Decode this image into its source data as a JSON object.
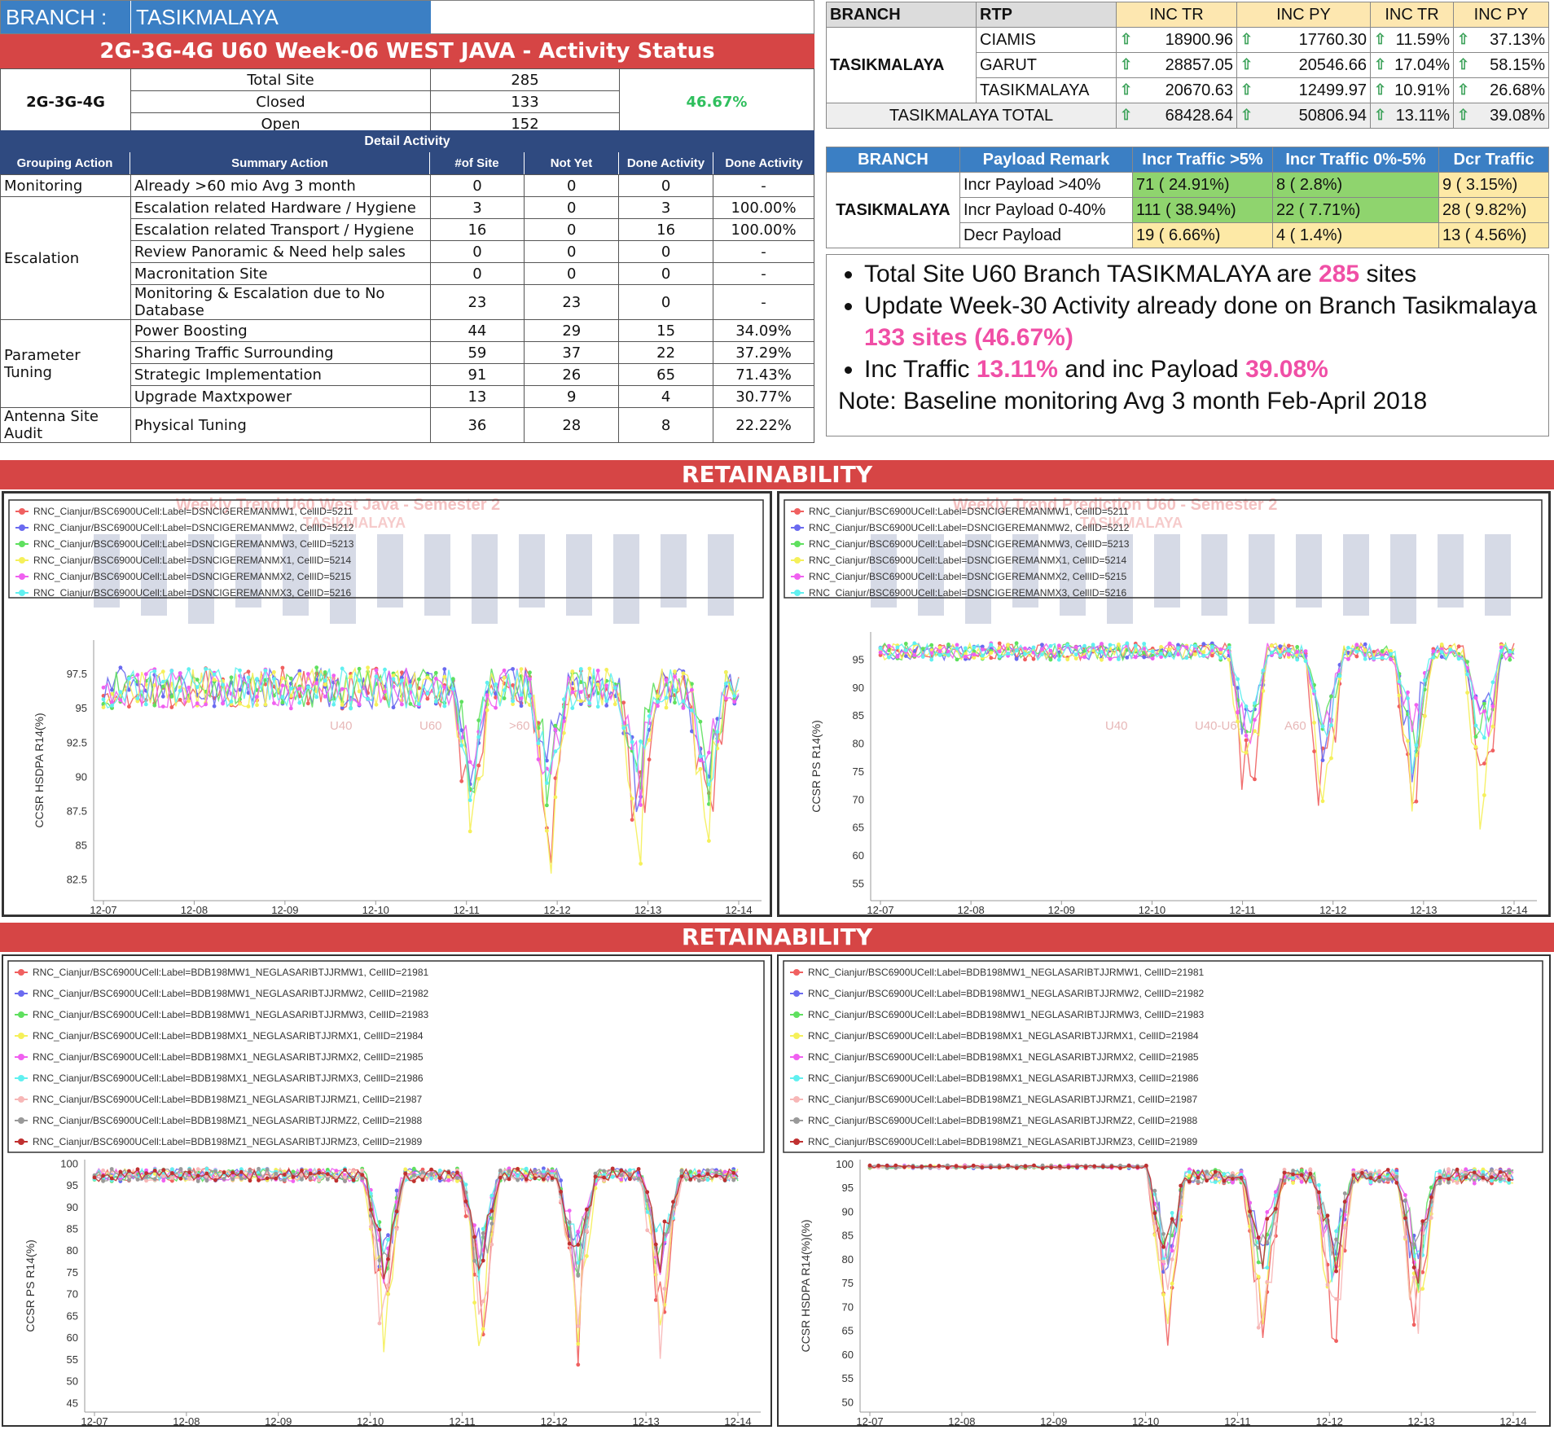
{
  "branch_header": {
    "label": "BRANCH :",
    "value": "TASIKMALAYA"
  },
  "title": "2G-3G-4G U60 Week-06 WEST JAVA - Activity Status",
  "summary": {
    "tech": "2G-3G-4G",
    "rows": [
      {
        "label": "Total Site",
        "value": "285"
      },
      {
        "label": "Closed",
        "value": "133"
      },
      {
        "label": "Open",
        "value": "152"
      }
    ],
    "percent": "46.67%"
  },
  "detail_title": "Detail Activity",
  "detail_columns": [
    "Grouping Action",
    "Summary Action",
    "#of Site",
    "Not Yet",
    "Done Activity",
    "Done Activity"
  ],
  "detail_groups": [
    {
      "group": "Monitoring",
      "rows": [
        {
          "action": "Already >60 mio Avg 3 month",
          "sites": "0",
          "not_yet": "0",
          "done": "0",
          "pct": "-"
        }
      ]
    },
    {
      "group": "Escalation",
      "rows": [
        {
          "action": "Escalation related Hardware / Hygiene",
          "sites": "3",
          "not_yet": "0",
          "done": "3",
          "pct": "100.00%"
        },
        {
          "action": "Escalation related Transport / Hygiene",
          "sites": "16",
          "not_yet": "0",
          "done": "16",
          "pct": "100.00%"
        },
        {
          "action": "Review Panoramic & Need help sales",
          "sites": "0",
          "not_yet": "0",
          "done": "0",
          "pct": "-"
        },
        {
          "action": "Macronitation Site",
          "sites": "0",
          "not_yet": "0",
          "done": "0",
          "pct": "-"
        },
        {
          "action": "Monitoring & Escalation due to No Database",
          "sites": "23",
          "not_yet": "23",
          "done": "0",
          "pct": "-"
        }
      ]
    },
    {
      "group": "Parameter Tuning",
      "rows": [
        {
          "action": "Power Boosting",
          "sites": "44",
          "not_yet": "29",
          "done": "15",
          "pct": "34.09%"
        },
        {
          "action": "Sharing Traffic Surrounding",
          "sites": "59",
          "not_yet": "37",
          "done": "22",
          "pct": "37.29%"
        },
        {
          "action": "Strategic Implementation",
          "sites": "91",
          "not_yet": "26",
          "done": "65",
          "pct": "71.43%"
        },
        {
          "action": "Upgrade Maxtxpower",
          "sites": "13",
          "not_yet": "9",
          "done": "4",
          "pct": "30.77%"
        }
      ]
    },
    {
      "group": "Antenna Site Audit",
      "rows": [
        {
          "action": "Physical Tuning",
          "sites": "36",
          "not_yet": "28",
          "done": "8",
          "pct": "22.22%"
        }
      ]
    }
  ],
  "traffic_table": {
    "headers": [
      "BRANCH",
      "RTP",
      "INC TR",
      "INC PY",
      "INC TR",
      "INC PY"
    ],
    "branch": "TASIKMALAYA",
    "rows": [
      {
        "rtp": "CIAMIS",
        "tr": "18900.96",
        "py": "17760.30",
        "inc_tr": "11.59%",
        "inc_py": "37.13%"
      },
      {
        "rtp": "GARUT",
        "tr": "28857.05",
        "py": "20546.66",
        "inc_tr": "17.04%",
        "inc_py": "58.15%"
      },
      {
        "rtp": "TASIKMALAYA",
        "tr": "20670.63",
        "py": "12499.97",
        "inc_tr": "10.91%",
        "inc_py": "26.68%"
      }
    ],
    "total": {
      "label": "TASIKMALAYA TOTAL",
      "tr": "68428.64",
      "py": "50806.94",
      "inc_tr": "13.11%",
      "inc_py": "39.08%"
    },
    "arrow_icon": "up-arrow-icon"
  },
  "payload_table": {
    "headers": [
      "BRANCH",
      "Payload Remark",
      "Incr Traffic >5%",
      "Incr Traffic 0%-5%",
      "Dcr Traffic"
    ],
    "branch": "TASIKMALAYA",
    "rows": [
      {
        "remark": "Incr Payload >40%",
        "a": "71 ( 24.91%)",
        "b": "8 ( 2.8%)",
        "c": "9 ( 3.15%)"
      },
      {
        "remark": "Incr Payload 0-40%",
        "a": "111 ( 38.94%)",
        "b": "22 ( 7.71%)",
        "c": "28 ( 9.82%)"
      },
      {
        "remark": "Decr Payload",
        "a": "19 ( 6.66%)",
        "b": "4 ( 1.4%)",
        "c": "13 ( 4.56%)"
      }
    ]
  },
  "notes": {
    "b1_pre": "Total Site U60 Branch TASIKMALAYA are ",
    "b1_hl": "285",
    "b1_post": " sites",
    "b2_pre": "Update Week-30 Activity already done on Branch Tasikmalaya ",
    "b2_hl": "133 sites (46.67%)",
    "b3_pre": "Inc Traffic ",
    "b3_hl1": "13.11%",
    "b3_mid": " and inc Payload ",
    "b3_hl2": "39.08%",
    "note": "Note: Baseline monitoring Avg 3 month Feb-April 2018"
  },
  "band_title": "RETAINABILITY",
  "colors": {
    "red": "#d64545",
    "blue": "#3b7fc4",
    "navy": "#2f4a80",
    "green_pct": "#2fbf5d",
    "pink": "#f04fa6"
  },
  "charts": [
    {
      "name": "chart-1",
      "ghost_title": "Weekly Trend U60 West Java - Semester 2",
      "ghost_sub": "TASIKMALAYA",
      "ghost_legend": [
        "U40",
        "U60",
        ">60"
      ],
      "ylabel": "CCSR HSDPA R14(%)",
      "yticks": [
        "97.5",
        "95",
        "92.5",
        "90",
        "87.5",
        "85",
        "82.5"
      ],
      "xticks": [
        "12-07",
        "12-08",
        "12-09",
        "12-10",
        "12-11",
        "12-12",
        "12-13",
        "12-14"
      ],
      "legend": [
        {
          "label": "RNC_Cianjur/BSC6900UCell:Label=DSNCIGEREMANMW1, CellID=5211",
          "color": "#f06060"
        },
        {
          "label": "RNC_Cianjur/BSC6900UCell:Label=DSNCIGEREMANMW2, CellID=5212",
          "color": "#6a6af0"
        },
        {
          "label": "RNC_Cianjur/BSC6900UCell:Label=DSNCIGEREMANMW3, CellID=5213",
          "color": "#5fe05f"
        },
        {
          "label": "RNC_Cianjur/BSC6900UCell:Label=DSNCIGEREMANMX1, CellID=5214",
          "color": "#f5f05a"
        },
        {
          "label": "RNC_Cianjur/BSC6900UCell:Label=DSNCIGEREMANMX2, CellID=5215",
          "color": "#f060f0"
        },
        {
          "label": "RNC_Cianjur/BSC6900UCell:Label=DSNCIGEREMANMX3, CellID=5216",
          "color": "#60f0f0"
        }
      ]
    },
    {
      "name": "chart-2",
      "ghost_title": "Weekly Trend Prediction U60 - Semester 2",
      "ghost_sub": "TASIKMALAYA",
      "ghost_legend": [
        "U40",
        "U40-U60",
        "A60"
      ],
      "ylabel": "CCSR PS R14(%)",
      "yticks": [
        "95",
        "90",
        "85",
        "80",
        "75",
        "70",
        "65",
        "60",
        "55"
      ],
      "xticks": [
        "12-07",
        "12-08",
        "12-09",
        "12-10",
        "12-11",
        "12-12",
        "12-13",
        "12-14"
      ],
      "legend": [
        {
          "label": "RNC_Cianjur/BSC6900UCell:Label=DSNCIGEREMANMW1, CellID=5211",
          "color": "#f06060"
        },
        {
          "label": "RNC_Cianjur/BSC6900UCell:Label=DSNCIGEREMANMW2, CellID=5212",
          "color": "#6a6af0"
        },
        {
          "label": "RNC_Cianjur/BSC6900UCell:Label=DSNCIGEREMANMW3, CellID=5213",
          "color": "#5fe05f"
        },
        {
          "label": "RNC_Cianjur/BSC6900UCell:Label=DSNCIGEREMANMX1, CellID=5214",
          "color": "#f5f05a"
        },
        {
          "label": "RNC_Cianjur/BSC6900UCell:Label=DSNCIGEREMANMX2, CellID=5215",
          "color": "#f060f0"
        },
        {
          "label": "RNC_Cianjur/BSC6900UCell:Label=DSNCIGEREMANMX3, CellID=5216",
          "color": "#60f0f0"
        }
      ]
    },
    {
      "name": "chart-3",
      "ylabel": "CCSR PS R14(%)",
      "yticks": [
        "100",
        "95",
        "90",
        "85",
        "80",
        "75",
        "70",
        "65",
        "60",
        "55",
        "50",
        "45"
      ],
      "xticks": [
        "12-07",
        "12-08",
        "12-09",
        "12-10",
        "12-11",
        "12-12",
        "12-13",
        "12-14"
      ],
      "legend": [
        {
          "label": "RNC_Cianjur/BSC6900UCell:Label=BDB198MW1_NEGLASARIBTJJRMW1, CellID=21981",
          "color": "#f06060"
        },
        {
          "label": "RNC_Cianjur/BSC6900UCell:Label=BDB198MW1_NEGLASARIBTJJRMW2, CellID=21982",
          "color": "#6a6af0"
        },
        {
          "label": "RNC_Cianjur/BSC6900UCell:Label=BDB198MW1_NEGLASARIBTJJRMW3, CellID=21983",
          "color": "#5fe05f"
        },
        {
          "label": "RNC_Cianjur/BSC6900UCell:Label=BDB198MX1_NEGLASARIBTJJRMX1, CellID=21984",
          "color": "#f5f05a"
        },
        {
          "label": "RNC_Cianjur/BSC6900UCell:Label=BDB198MX1_NEGLASARIBTJJRMX2, CellID=21985",
          "color": "#f060f0"
        },
        {
          "label": "RNC_Cianjur/BSC6900UCell:Label=BDB198MX1_NEGLASARIBTJJRMX3, CellID=21986",
          "color": "#60f0f0"
        },
        {
          "label": "RNC_Cianjur/BSC6900UCell:Label=BDB198MZ1_NEGLASARIBTJJRMZ1, CellID=21987",
          "color": "#f7b7b7"
        },
        {
          "label": "RNC_Cianjur/BSC6900UCell:Label=BDB198MZ1_NEGLASARIBTJJRMZ2, CellID=21988",
          "color": "#999999"
        },
        {
          "label": "RNC_Cianjur/BSC6900UCell:Label=BDB198MZ1_NEGLASARIBTJJRMZ3, CellID=21989",
          "color": "#c03030"
        }
      ]
    },
    {
      "name": "chart-4",
      "ylabel": "CCSR HSDPA R14(%)(%)",
      "yticks": [
        "100",
        "95",
        "90",
        "85",
        "80",
        "75",
        "70",
        "65",
        "60",
        "55",
        "50"
      ],
      "xticks": [
        "12-07",
        "12-08",
        "12-09",
        "12-10",
        "12-11",
        "12-12",
        "12-13",
        "12-14"
      ],
      "legend": [
        {
          "label": "RNC_Cianjur/BSC6900UCell:Label=BDB198MW1_NEGLASARIBTJJRMW1, CellID=21981",
          "color": "#f06060"
        },
        {
          "label": "RNC_Cianjur/BSC6900UCell:Label=BDB198MW1_NEGLASARIBTJJRMW2, CellID=21982",
          "color": "#6a6af0"
        },
        {
          "label": "RNC_Cianjur/BSC6900UCell:Label=BDB198MW1_NEGLASARIBTJJRMW3, CellID=21983",
          "color": "#5fe05f"
        },
        {
          "label": "RNC_Cianjur/BSC6900UCell:Label=BDB198MX1_NEGLASARIBTJJRMX1, CellID=21984",
          "color": "#f5f05a"
        },
        {
          "label": "RNC_Cianjur/BSC6900UCell:Label=BDB198MX1_NEGLASARIBTJJRMX2, CellID=21985",
          "color": "#f060f0"
        },
        {
          "label": "RNC_Cianjur/BSC6900UCell:Label=BDB198MX1_NEGLASARIBTJJRMX3, CellID=21986",
          "color": "#60f0f0"
        },
        {
          "label": "RNC_Cianjur/BSC6900UCell:Label=BDB198MZ1_NEGLASARIBTJJRMZ1, CellID=21987",
          "color": "#f7b7b7"
        },
        {
          "label": "RNC_Cianjur/BSC6900UCell:Label=BDB198MZ1_NEGLASARIBTJJRMZ2, CellID=21988",
          "color": "#999999"
        },
        {
          "label": "RNC_Cianjur/BSC6900UCell:Label=BDB198MZ1_NEGLASARIBTJJRMZ3, CellID=21989",
          "color": "#c03030"
        }
      ]
    }
  ]
}
